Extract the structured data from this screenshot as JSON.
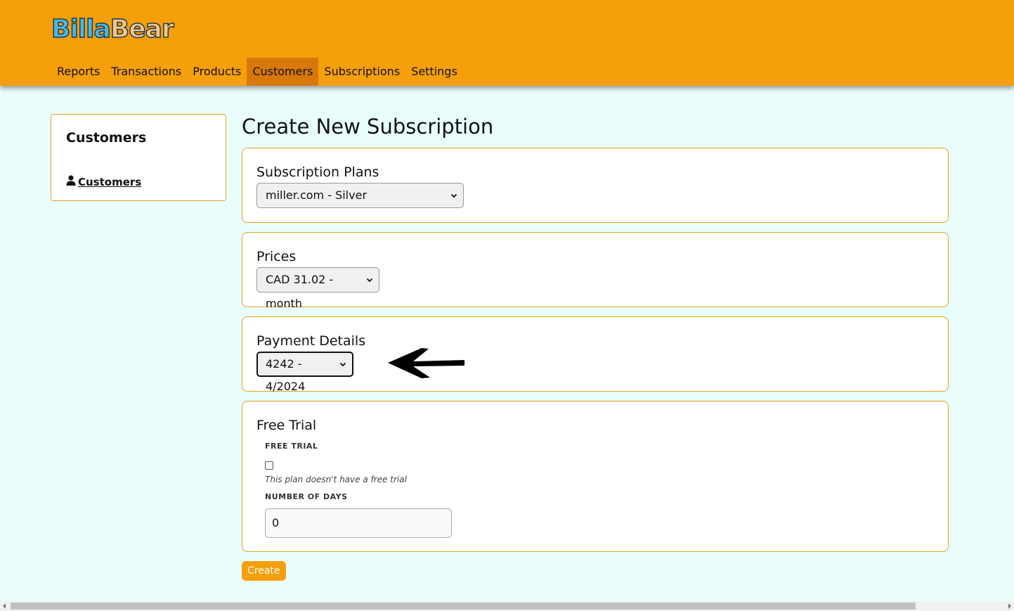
{
  "brand": {
    "logo_part1": "Billa",
    "logo_part2": "Bear"
  },
  "nav": {
    "items": [
      "Reports",
      "Transactions",
      "Products",
      "Customers",
      "Subscriptions",
      "Settings"
    ],
    "active": "Customers"
  },
  "sidebar": {
    "title": "Customers",
    "link_label": "Customers",
    "link_icon": "user-icon"
  },
  "page": {
    "title": "Create New Subscription"
  },
  "subscription_plans": {
    "heading": "Subscription Plans",
    "selected": "miller.com - Silver"
  },
  "prices": {
    "heading": "Prices",
    "selected": "CAD 31.02 - month"
  },
  "payment_details": {
    "heading": "Payment Details",
    "selected": "4242 - 4/2024"
  },
  "free_trial": {
    "heading": "Free Trial",
    "checkbox_label": "FREE TRIAL",
    "checked": false,
    "help_text": "This plan doesn't have a free trial",
    "days_label": "NUMBER OF DAYS",
    "days_value": "0"
  },
  "actions": {
    "create_label": "Create"
  },
  "colors": {
    "header": "#f59f0b",
    "active_nav": "#d9780a",
    "page_background": "#eafdfd",
    "card_border": "#e2a21d",
    "button": "#f59f0b"
  }
}
